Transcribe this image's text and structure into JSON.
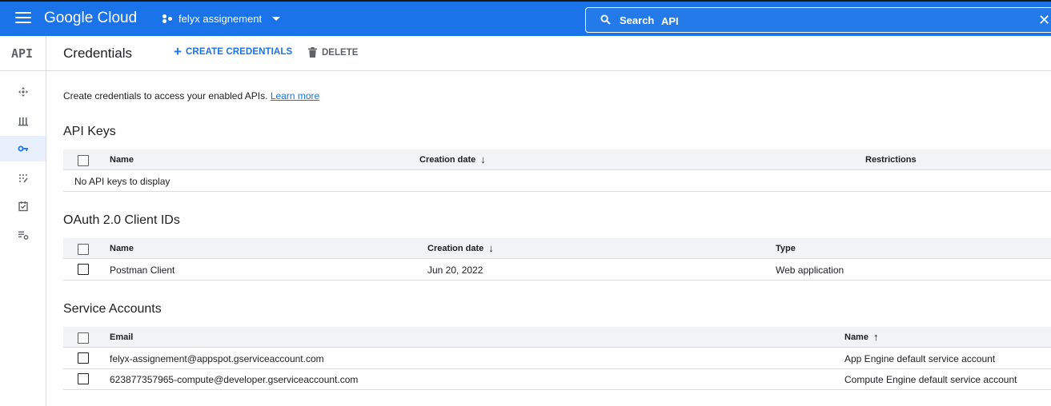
{
  "topbar": {
    "logo": "Google Cloud",
    "project": "felyx assignement",
    "search_label": "Search",
    "search_value": "API",
    "clear_glyph": "✕",
    "brand_color": "#1a73e8"
  },
  "rail": {
    "logo": "API",
    "items": [
      {
        "icon": "dashboard-icon"
      },
      {
        "icon": "library-icon"
      },
      {
        "icon": "credentials-key-icon",
        "active": true
      },
      {
        "icon": "oauth-consent-icon"
      },
      {
        "icon": "domain-verification-icon"
      },
      {
        "icon": "page-settings-icon"
      }
    ]
  },
  "header": {
    "title": "Credentials",
    "create_label": "CREATE CREDENTIALS",
    "delete_label": "DELETE"
  },
  "intro": {
    "text": "Create credentials to access your enabled APIs.",
    "link": "Learn more"
  },
  "api_keys": {
    "title": "API Keys",
    "columns": [
      "Name",
      "Creation date",
      "Restrictions"
    ],
    "sort_arrow": "↓",
    "empty_text": "No API keys to display"
  },
  "oauth": {
    "title": "OAuth 2.0 Client IDs",
    "columns": [
      "Name",
      "Creation date",
      "Type"
    ],
    "sort_arrow": "↓",
    "rows": [
      {
        "name": "Postman Client",
        "date": "Jun 20, 2022",
        "type": "Web application"
      }
    ]
  },
  "service_accounts": {
    "title": "Service Accounts",
    "columns": [
      "Email",
      "Name"
    ],
    "sort_arrow": "↑",
    "rows": [
      {
        "email": "felyx-assignement@appspot.gserviceaccount.com",
        "name": "App Engine default service account"
      },
      {
        "email": "623877357965-compute@developer.gserviceaccount.com",
        "name": "Compute Engine default service account"
      }
    ]
  }
}
